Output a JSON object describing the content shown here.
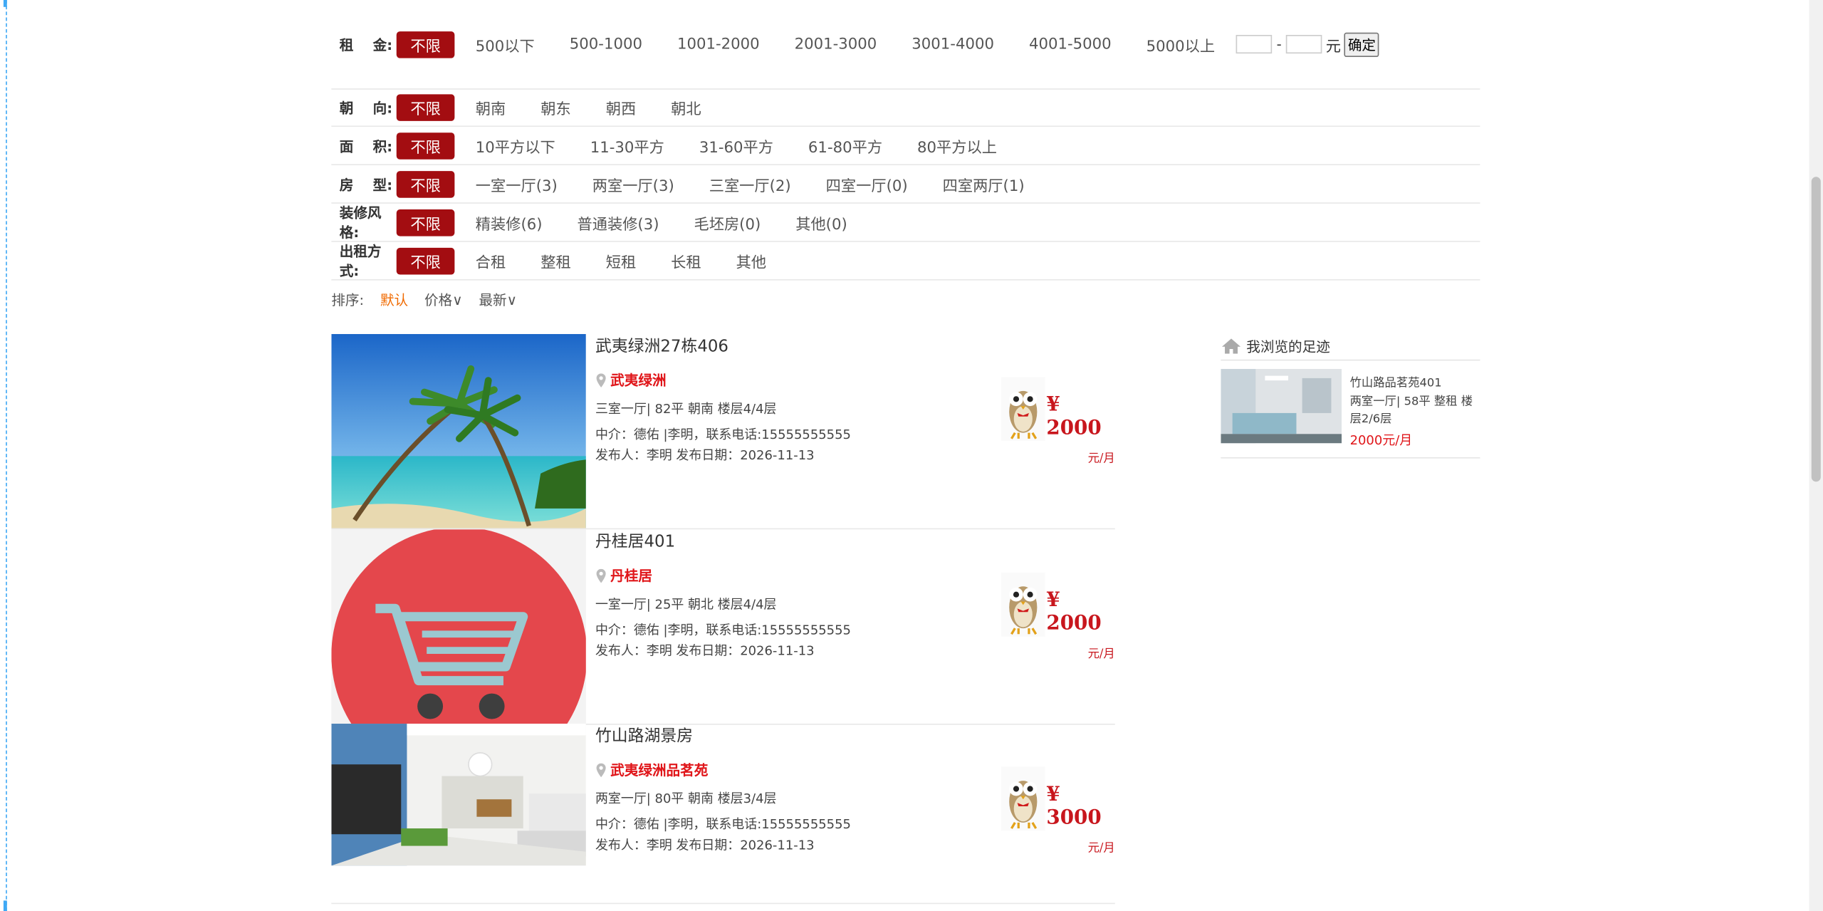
{
  "filters": {
    "rent": {
      "label": "租    金:",
      "all": "不限",
      "options": [
        "500以下",
        "500-1000",
        "1001-2000",
        "2001-3000",
        "3001-4000",
        "4001-5000",
        "5000以上"
      ],
      "dash": "-",
      "unit": "元",
      "confirm": "确定"
    },
    "orientation": {
      "label": "朝    向:",
      "all": "不限",
      "options": [
        "朝南",
        "朝东",
        "朝西",
        "朝北"
      ]
    },
    "area": {
      "label": "面    积:",
      "all": "不限",
      "options": [
        "10平方以下",
        "11-30平方",
        "31-60平方",
        "61-80平方",
        "80平方以上"
      ]
    },
    "layout": {
      "label": "房    型:",
      "all": "不限",
      "options": [
        "一室一厅(3)",
        "两室一厅(3)",
        "三室一厅(2)",
        "四室一厅(0)",
        "四室两厅(1)"
      ]
    },
    "decor": {
      "label": "装修风格:",
      "all": "不限",
      "options": [
        "精装修(6)",
        "普通装修(3)",
        "毛坯房(0)",
        "其他(0)"
      ]
    },
    "renttype": {
      "label": "出租方式:",
      "all": "不限",
      "options": [
        "合租",
        "整租",
        "短租",
        "长租",
        "其他"
      ]
    }
  },
  "sort": {
    "label": "排序:",
    "default": "默认",
    "price": "价格∨",
    "newest": "最新∨"
  },
  "listings": [
    {
      "title": "武夷绿洲27栋406",
      "zone": "武夷绿洲",
      "meta": "三室一厅| 82平 朝南 楼层4/4层",
      "agent": "中介：德佑 |李明，联系电话:15555555555",
      "publisher": "发布人：李明 发布日期：2026-11-13",
      "price": "¥ 2000",
      "per": "元/月",
      "image": "palm-beach"
    },
    {
      "title": "丹桂居401",
      "zone": "丹桂居",
      "meta": "一室一厅| 25平 朝北 楼层4/4层",
      "agent": "中介：德佑 |李明，联系电话:15555555555",
      "publisher": "发布人：李明 发布日期：2026-11-13",
      "price": "¥ 2000",
      "per": "元/月",
      "image": "shopping-cart"
    },
    {
      "title": "竹山路湖景房",
      "zone": "武夷绿洲品茗苑",
      "meta": "两室一厅| 80平 朝南 楼层3/4层",
      "agent": "中介：德佑 |李明，联系电话:15555555555",
      "publisher": "发布人：李明 发布日期：2026-11-13",
      "price": "¥ 3000",
      "per": "元/月",
      "image": "living-room"
    }
  ],
  "sidebar": {
    "title": "我浏览的足迹",
    "item": {
      "title": "竹山路品茗苑401",
      "meta": "两室一厅| 58平 整租 楼层2/6层",
      "price": "2000元/月"
    }
  },
  "colors": {
    "accent": "#a30d11",
    "price": "#c8161d",
    "sort_active": "#f06a00"
  }
}
